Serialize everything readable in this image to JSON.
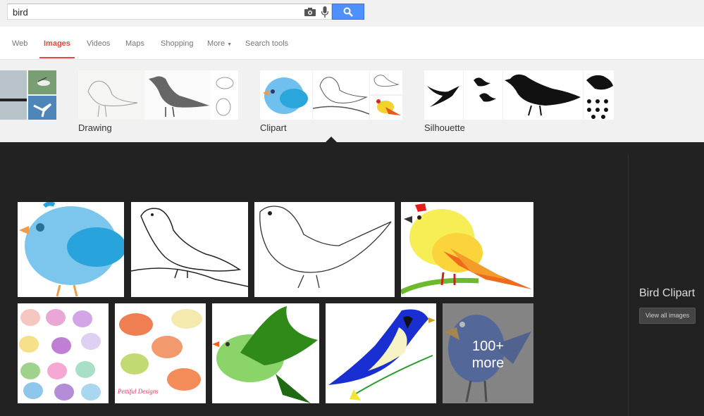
{
  "search": {
    "query": "bird"
  },
  "nav": {
    "tabs": [
      {
        "label": "Web"
      },
      {
        "label": "Images"
      },
      {
        "label": "Videos"
      },
      {
        "label": "Maps"
      },
      {
        "label": "Shopping"
      },
      {
        "label": "More"
      },
      {
        "label": "Search tools"
      }
    ],
    "active_tab": "Images"
  },
  "related": [
    {
      "label": "Drawing"
    },
    {
      "label": "Clipart"
    },
    {
      "label": "Silhouette"
    }
  ],
  "panel": {
    "title": "Bird Clipart",
    "view_all_label": "View all images",
    "more_count": "100+",
    "more_label": "more"
  },
  "colors": {
    "accent_red": "#dd4b39",
    "search_blue": "#4d90fe",
    "panel_bg": "#222222"
  }
}
